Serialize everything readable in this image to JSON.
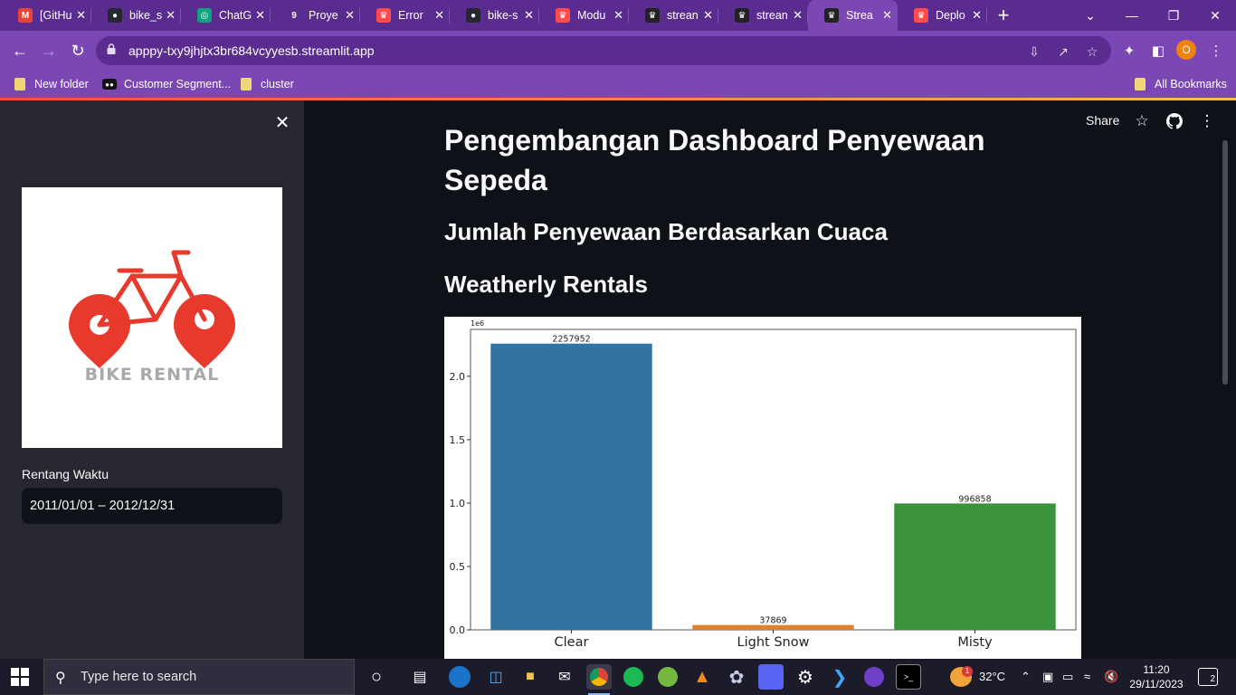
{
  "browser": {
    "tabs": [
      {
        "label": "[GitHu",
        "favicon": "gmail-icon",
        "color": "#ea4335",
        "glyph": "M"
      },
      {
        "label": "bike_s",
        "favicon": "github-icon",
        "color": "#24292f",
        "glyph": "●"
      },
      {
        "label": "ChatG",
        "favicon": "chatgpt-icon",
        "color": "#10a37f",
        "glyph": "◎"
      },
      {
        "label": "Proye",
        "favicon": "nine-icon",
        "color": "#5b2c8f",
        "glyph": "9"
      },
      {
        "label": "Error",
        "favicon": "streamlit-icon",
        "color": "#ff4b4b",
        "glyph": "♛"
      },
      {
        "label": "bike-s",
        "favicon": "github-icon",
        "color": "#24292f",
        "glyph": "●"
      },
      {
        "label": "Modu",
        "favicon": "streamlit-icon",
        "color": "#ff4b4b",
        "glyph": "♛"
      },
      {
        "label": "strean",
        "favicon": "streamlit-crown-icon",
        "color": "#222222",
        "glyph": "♛"
      },
      {
        "label": "strean",
        "favicon": "streamlit-crown-icon",
        "color": "#222222",
        "glyph": "♛"
      },
      {
        "label": "Strea",
        "favicon": "streamlit-crown-icon",
        "color": "#222222",
        "glyph": "♛",
        "active": true
      },
      {
        "label": "Deplo",
        "favicon": "streamlit-icon",
        "color": "#ff4b4b",
        "glyph": "♛"
      }
    ],
    "new_tab": "+",
    "url": "apppy-txy9jhjtx3br684vcyyesb.streamlit.app",
    "profile_initial": "O",
    "bookmarks": [
      {
        "label": "New folder",
        "icon": "folder-icon"
      },
      {
        "label": "Customer Segment...",
        "icon": "medium-icon"
      },
      {
        "label": "cluster",
        "icon": "folder-icon"
      }
    ],
    "all_bookmarks": "All Bookmarks"
  },
  "sidebar": {
    "logo_text": "BIKE RENTAL",
    "date_label": "Rentang Waktu",
    "date_value": "2011/01/01 – 2012/12/31"
  },
  "main": {
    "share": "Share",
    "title": "Pengembangan Dashboard Penyewaan Sepeda",
    "subheader": "Jumlah Penyewaan Berdasarkan Cuaca",
    "chart_heading": "Weatherly Rentals"
  },
  "chart_data": {
    "type": "bar",
    "categories": [
      "Clear",
      "Light Snow",
      "Misty"
    ],
    "values": [
      2257952,
      37869,
      996858
    ],
    "data_labels": [
      "2257952",
      "37869",
      "996858"
    ],
    "colors": [
      "#3274a1",
      "#e1812c",
      "#3a923a"
    ],
    "ylim": [
      0,
      2370000
    ],
    "yticks": [
      0,
      500000,
      1000000,
      1500000,
      2000000
    ],
    "ytick_labels": [
      "0.0",
      "0.5",
      "1.0",
      "1.5",
      "2.0"
    ],
    "offset_label": "1e6",
    "grid": false
  },
  "taskbar": {
    "search_placeholder": "Type here to search",
    "weather": "32°C",
    "weather_badge": "1",
    "time": "11:20",
    "date": "29/11/2023",
    "notifications": "2"
  }
}
